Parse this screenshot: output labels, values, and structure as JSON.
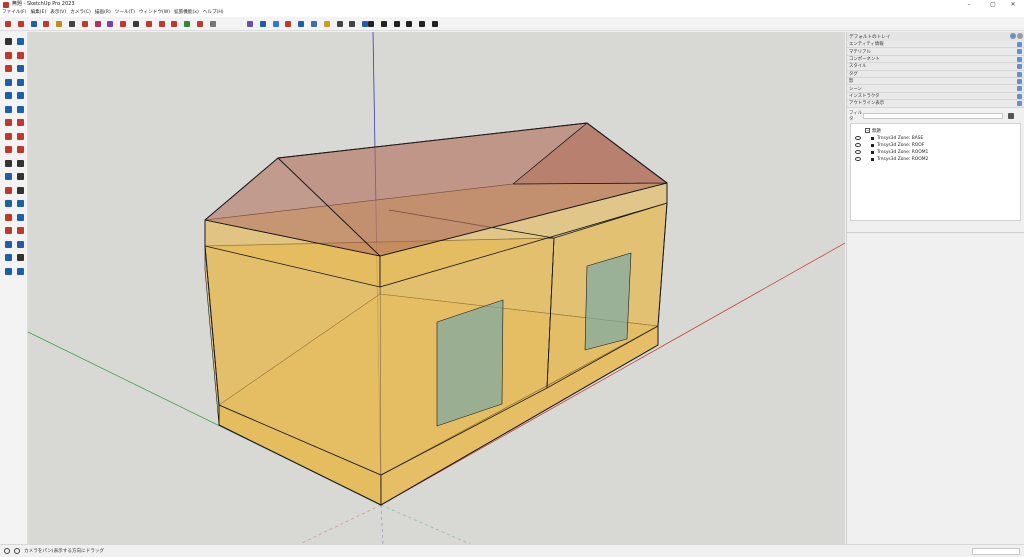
{
  "window": {
    "title": "無題 - SketchUp Pro 2023",
    "controls": [
      "–",
      "▢",
      "✕"
    ]
  },
  "menu": [
    "ファイル(F)",
    "編集(E)",
    "表示(V)",
    "カメラ(C)",
    "描画(R)",
    "ツール(T)",
    "ウィンドウ(W)",
    "拡張機能(x)",
    "ヘルプ(H)"
  ],
  "toolbar": {
    "groups": [
      {
        "icons": [
          "select-icon",
          "paint-icon",
          "eraser-icon",
          "tape-icon",
          "line-icon",
          "arc-icon",
          "shapes-icon",
          "text-icon",
          "pushpull-icon",
          "offset-icon",
          "move-icon",
          "rotate-icon",
          "scale-icon",
          "tape-measure-icon",
          "ruby-icon",
          "component-icon",
          "extension-icon"
        ],
        "colors": [
          "#c0392b",
          "#c0392b",
          "#1f5fa8",
          "#c0392b",
          "#c48a1a",
          "#444444",
          "#c0392b",
          "#b03060",
          "#7a3fb0",
          "#c0392b",
          "#3a3a3a",
          "#c0392b",
          "#c0392b",
          "#c0392b",
          "#2d8a2d",
          "#c0392b",
          "#777777"
        ]
      },
      {
        "icons": [
          "iso-view-icon",
          "top-view-icon",
          "front-view-icon",
          "right-view-icon",
          "back-view-icon",
          "left-view-icon",
          "xray-icon",
          "wireframe-icon",
          "hidden-line-icon",
          "shaded-icon"
        ],
        "colors": [
          "#6a4fb0",
          "#1f5fa8",
          "#2a7fc4",
          "#c0392b",
          "#1f5fa8",
          "#3d6fb0",
          "#caa018",
          "#444444",
          "#444444",
          "#1f5fa8"
        ]
      },
      {
        "icons": [
          "scene-add-icon",
          "first-scene-icon",
          "prev-scene-icon",
          "play-icon",
          "next-scene-icon",
          "last-scene-icon"
        ],
        "colors": [
          "#222222",
          "#222222",
          "#222222",
          "#222222",
          "#222222",
          "#222222"
        ]
      }
    ]
  },
  "left_tools": {
    "icons": [
      "select-icon",
      "make-component-icon",
      "paint-bucket-icon",
      "eraser-icon",
      "line-icon",
      "freehand-icon",
      "rectangle-icon",
      "rotated-rect-icon",
      "circle-icon",
      "polygon-icon",
      "arc-icon",
      "pie-icon",
      "push-pull-icon",
      "follow-me-icon",
      "move-icon",
      "rotate-icon",
      "scale-icon",
      "offset-icon",
      "tape-measure-icon",
      "dimension-icon",
      "protractor-icon",
      "text-icon",
      "axes-icon",
      "3d-text-icon",
      "section-plane-icon",
      "walk-icon",
      "orbit-icon",
      "pan-icon",
      "zoom-icon",
      "zoom-window-icon",
      "zoom-extents-icon",
      "position-camera-icon",
      "look-around-icon",
      "walk-person-icon",
      "sandbox-icon",
      "sandbox-smoove-icon"
    ],
    "colors": [
      "#333333",
      "#1f5fa8",
      "#c0392b",
      "#c0392b",
      "#c0392b",
      "#1f5fa8",
      "#1f5fa8",
      "#1f5fa8",
      "#1f5fa8",
      "#1f5fa8",
      "#1f5fa8",
      "#1f5fa8",
      "#c0392b",
      "#c0392b",
      "#c0392b",
      "#c0392b",
      "#c0392b",
      "#c0392b",
      "#333333",
      "#333333",
      "#1f5fa8",
      "#333333",
      "#c0392b",
      "#333333",
      "#1f5fa8",
      "#1f5fa8",
      "#c0392b",
      "#1f5fa8",
      "#c0392b",
      "#c0392b",
      "#1f5fa8",
      "#1f5fa8",
      "#1f5fa8",
      "#333333",
      "#1f5fa8",
      "#1f5fa8"
    ]
  },
  "tray": {
    "title": "デフォルトのトレイ",
    "panels": [
      "エンティティ情報",
      "マテリアル",
      "コンポーネント",
      "スタイル",
      "タグ",
      "影",
      "シーン",
      "インストラクタ",
      "アウトライン表示"
    ],
    "filter_label": "フィルタ",
    "outliner": {
      "root": "無題",
      "items": [
        "Trnsys3d Zone: BASE",
        "Trnsys3d Zone: ROOF",
        "Trnsys3d Zone: ROOM1",
        "Trnsys3d Zone: ROOM2"
      ]
    }
  },
  "status": {
    "hint": "カメラをパン(表示する方向にドラッグ"
  },
  "colors": {
    "zone_fill": "#e8b84a",
    "roof_fill": "#b06a56",
    "window_fill": "#7aaaa6",
    "axis_red": "#c0392b",
    "axis_green": "#2e9a3a",
    "axis_blue": "#3a3ab8",
    "background": "#d8d8d4"
  }
}
